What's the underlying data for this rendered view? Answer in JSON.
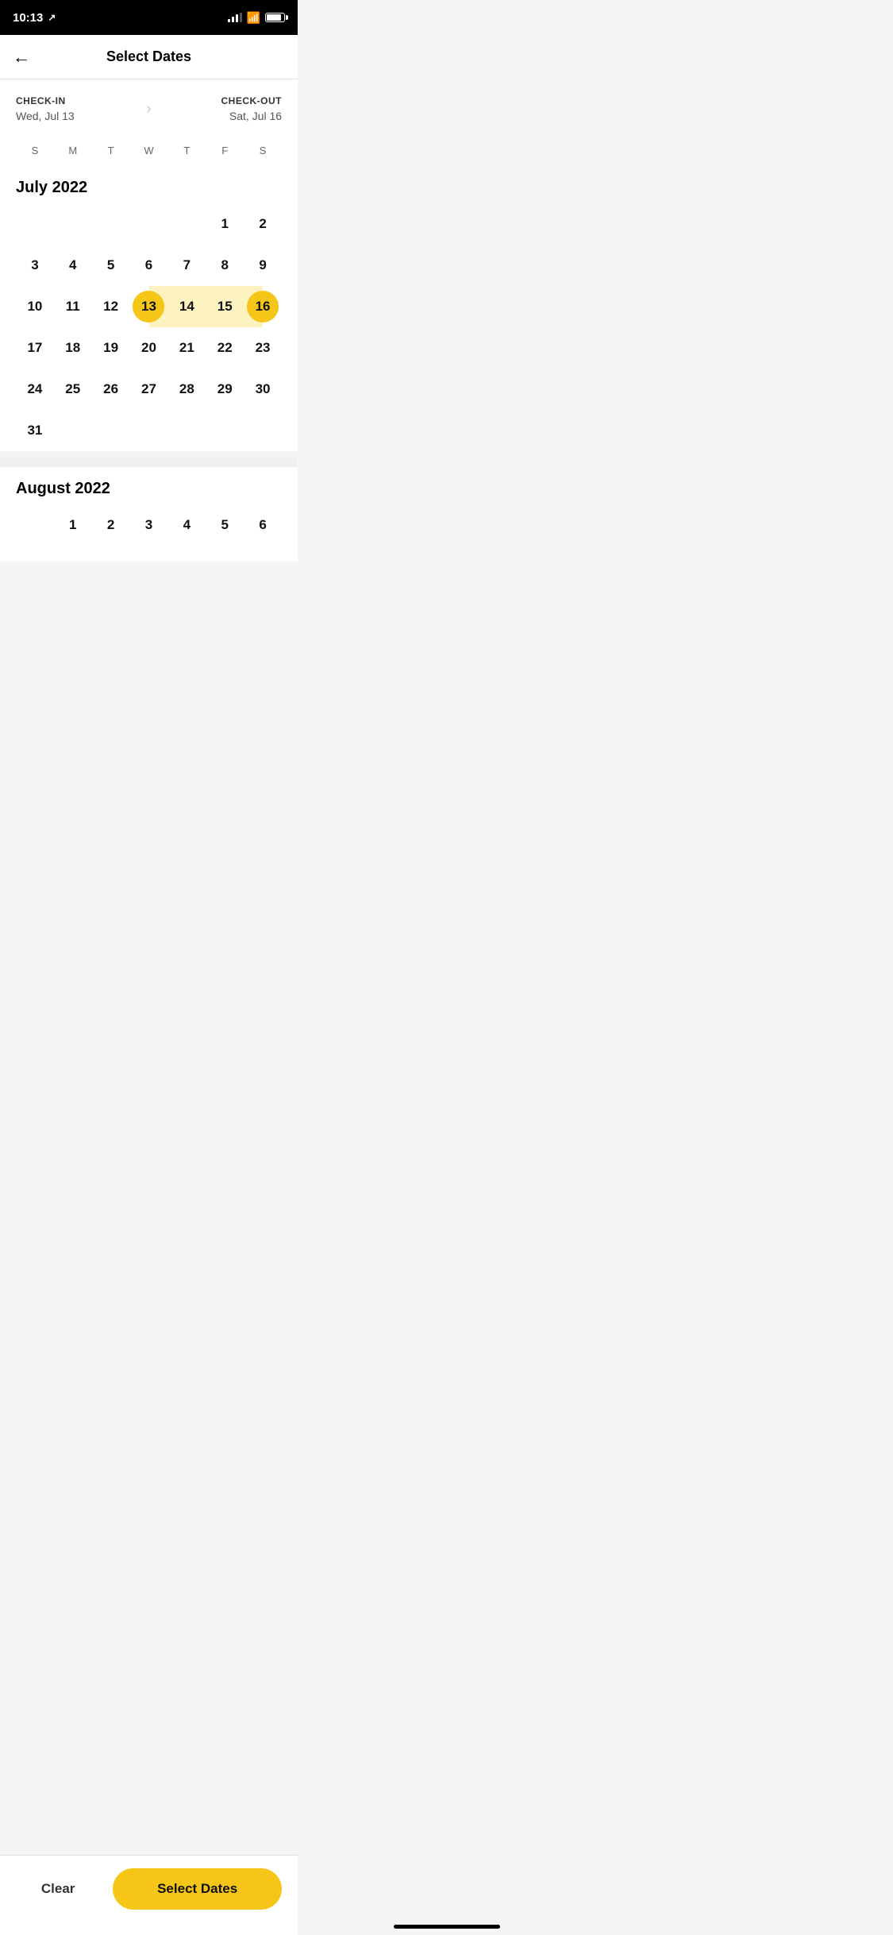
{
  "statusBar": {
    "time": "10:13",
    "location_icon": "arrow-up-right"
  },
  "header": {
    "back_label": "←",
    "title": "Select Dates"
  },
  "dateSelection": {
    "checkIn": {
      "label": "CHECK-IN",
      "value": "Wed, Jul 13"
    },
    "checkOut": {
      "label": "CHECK-OUT",
      "value": "Sat, Jul 16"
    }
  },
  "dayHeaders": [
    "S",
    "M",
    "T",
    "W",
    "T",
    "F",
    "S"
  ],
  "july2022": {
    "monthTitle": "July 2022",
    "cells": [
      {
        "day": "",
        "empty": true
      },
      {
        "day": "",
        "empty": true
      },
      {
        "day": "",
        "empty": true
      },
      {
        "day": "",
        "empty": true
      },
      {
        "day": "",
        "empty": true
      },
      {
        "day": "1"
      },
      {
        "day": "2"
      },
      {
        "day": "3"
      },
      {
        "day": "4"
      },
      {
        "day": "5"
      },
      {
        "day": "6"
      },
      {
        "day": "7"
      },
      {
        "day": "8"
      },
      {
        "day": "9"
      },
      {
        "day": "10"
      },
      {
        "day": "11"
      },
      {
        "day": "12"
      },
      {
        "day": "13",
        "selectedStart": true
      },
      {
        "day": "14",
        "inRange": true
      },
      {
        "day": "15",
        "inRange": true
      },
      {
        "day": "16",
        "selectedEnd": true
      },
      {
        "day": "17"
      },
      {
        "day": "18"
      },
      {
        "day": "19"
      },
      {
        "day": "20"
      },
      {
        "day": "21"
      },
      {
        "day": "22"
      },
      {
        "day": "23"
      },
      {
        "day": "24"
      },
      {
        "day": "25"
      },
      {
        "day": "26"
      },
      {
        "day": "27"
      },
      {
        "day": "28"
      },
      {
        "day": "29"
      },
      {
        "day": "30"
      },
      {
        "day": "31"
      },
      {
        "day": "",
        "empty": true
      },
      {
        "day": "",
        "empty": true
      },
      {
        "day": "",
        "empty": true
      },
      {
        "day": "",
        "empty": true
      },
      {
        "day": "",
        "empty": true
      },
      {
        "day": "",
        "empty": true
      }
    ]
  },
  "august2022": {
    "monthTitle": "August 2022",
    "cells": [
      {
        "day": "",
        "empty": true
      },
      {
        "day": "1"
      },
      {
        "day": "2"
      },
      {
        "day": "3"
      },
      {
        "day": "4"
      },
      {
        "day": "5"
      },
      {
        "day": "6"
      }
    ]
  },
  "bottomBar": {
    "clearLabel": "Clear",
    "selectDatesLabel": "Select Dates"
  }
}
